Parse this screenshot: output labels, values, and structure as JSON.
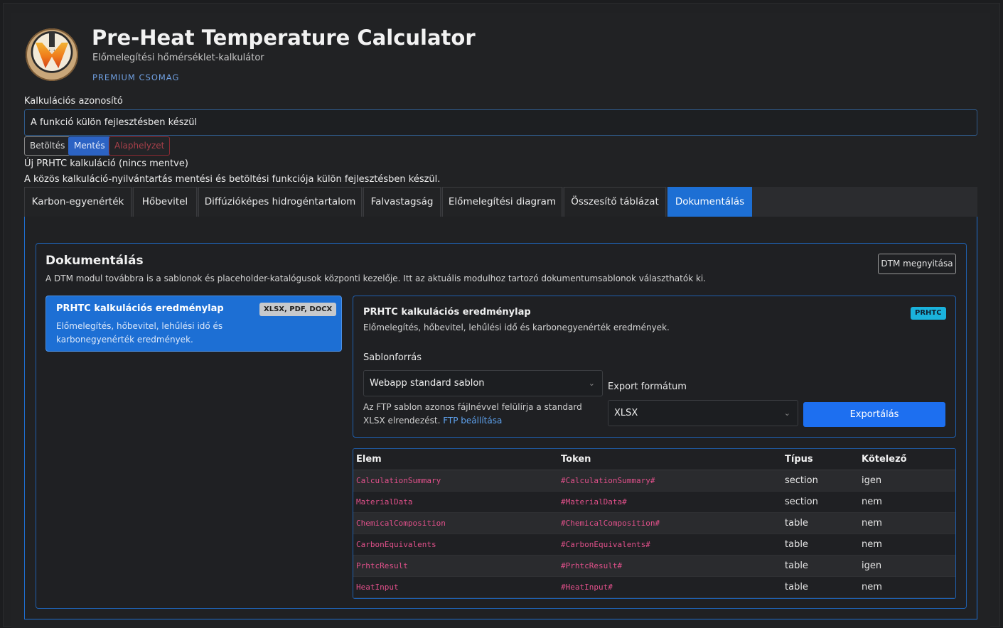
{
  "header": {
    "title": "Pre-Heat Temperature Calculator",
    "subtitle": "Előmelegítési hőmérséklet-kalkulátor",
    "edition": "PREMIUM CSOMAG"
  },
  "calc": {
    "label": "Kalkulációs azonosító",
    "value": "A funkció külön fejlesztésben készül",
    "load_label": "Betöltés",
    "save_label": "Mentés",
    "reset_label": "Alaphelyzet",
    "status": "Új PRHTC kalkuláció (nincs mentve)",
    "notice": "A közös kalkuláció-nyilvántartás mentési és betöltési funkciója külön fejlesztésben készül."
  },
  "tabs": [
    {
      "label": "Karbon-egyenérték"
    },
    {
      "label": "Hőbevitel"
    },
    {
      "label": "Diffúzióképes hidrogéntartalom"
    },
    {
      "label": "Falvastagság"
    },
    {
      "label": "Előmelegítési diagram"
    },
    {
      "label": "Összesítő táblázat"
    },
    {
      "label": "Dokumentálás"
    }
  ],
  "doc": {
    "title": "Dokumentálás",
    "description": "A DTM modul továbbra is a sablonok és placeholder-katalógusok központi kezelője. Itt az aktuális modulhoz tartozó dokumentumsablonok választhatók ki.",
    "dtm_button": "DTM megnyitása",
    "template_card": {
      "title": "PRHTC kalkulációs eredménylap",
      "formats": "XLSX, PDF, DOCX",
      "description": "Előmelegítés, hőbevitel, lehűlési idő és karbonegyenérték eredmények."
    },
    "detail": {
      "title": "PRHTC kalkulációs eredménylap",
      "badge": "PRHTC",
      "description": "Előmelegítés, hőbevitel, lehűlési idő és karbonegyenérték eredmények.",
      "source_label": "Sablonforrás",
      "source_value": "Webapp standard sablon",
      "source_help": "Az FTP sablon azonos fájlnévvel felülírja a standard XLSX elrendezést.",
      "ftp_link": "FTP beállítása",
      "format_label": "Export formátum",
      "format_value": "XLSX",
      "export_button": "Exportálás"
    },
    "table": {
      "headers": [
        "Elem",
        "Token",
        "Típus",
        "Kötelező"
      ],
      "rows": [
        [
          "CalculationSummary",
          "#CalculationSummary#",
          "section",
          "igen"
        ],
        [
          "MaterialData",
          "#MaterialData#",
          "section",
          "nem"
        ],
        [
          "ChemicalComposition",
          "#ChemicalComposition#",
          "table",
          "nem"
        ],
        [
          "CarbonEquivalents",
          "#CarbonEquivalents#",
          "table",
          "nem"
        ],
        [
          "PrhtcResult",
          "#PrhtcResult#",
          "table",
          "igen"
        ],
        [
          "HeatInput",
          "#HeatInput#",
          "table",
          "nem"
        ]
      ]
    }
  },
  "colors": {
    "accent": "#1d6fd4",
    "danger": "#8b2a33",
    "code": "#e0508a",
    "badge_info": "#1ab2dc"
  }
}
